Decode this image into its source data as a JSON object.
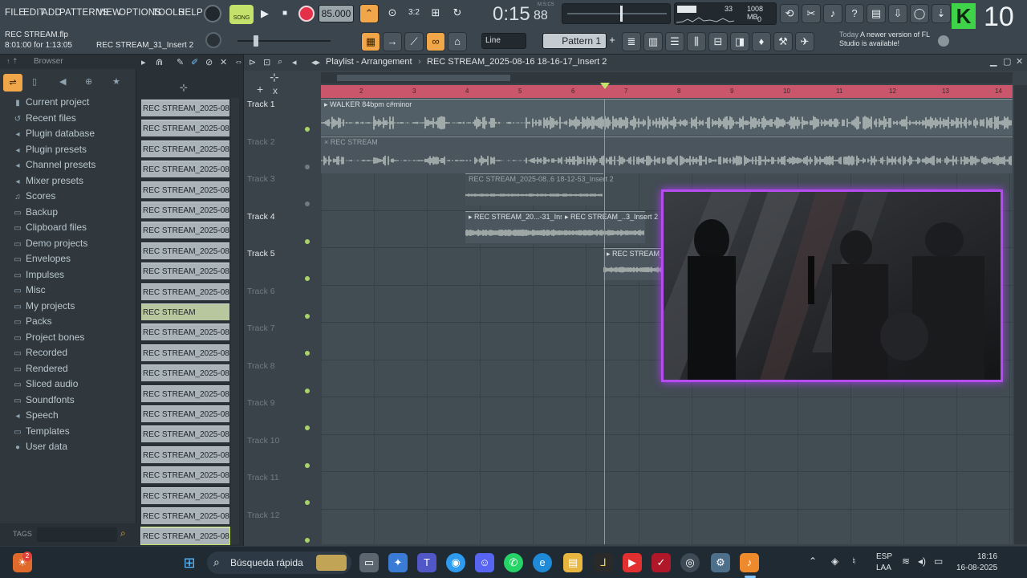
{
  "menu": [
    "FILE",
    "EDIT",
    "ADD",
    "PATTERNS",
    "VIEW",
    "OPTIONS",
    "TOOLS",
    "HELP"
  ],
  "transport": {
    "song_label": "SONG",
    "tempo": "85.000",
    "time": "0:15",
    "time_sub": "88",
    "time_unit": "M:S:CS",
    "cpu": "33",
    "memory": "1008 MB",
    "voices": "0"
  },
  "project": {
    "file": "REC STREAM.flp",
    "position": "8:01:00 for 1:13:05",
    "insert": "REC STREAM_31_Insert 2"
  },
  "toolbar": {
    "snap": "Line",
    "pattern": "Pattern 1",
    "badge": "10"
  },
  "news": {
    "today": "Today",
    "message": "A newer version of FL Studio is available!"
  },
  "browser": {
    "title": "Browser",
    "tags_label": "TAGS",
    "items": [
      {
        "label": "Current project",
        "icon": "project-icon"
      },
      {
        "label": "Recent files",
        "icon": "recent-icon"
      },
      {
        "label": "Plugin database",
        "icon": "plugin-icon"
      },
      {
        "label": "Plugin presets",
        "icon": "plugin-icon"
      },
      {
        "label": "Channel presets",
        "icon": "plugin-icon"
      },
      {
        "label": "Mixer presets",
        "icon": "plugin-icon"
      },
      {
        "label": "Scores",
        "icon": "note-icon"
      },
      {
        "label": "Backup",
        "icon": "folder-icon"
      },
      {
        "label": "Clipboard files",
        "icon": "folder-icon"
      },
      {
        "label": "Demo projects",
        "icon": "folder-icon"
      },
      {
        "label": "Envelopes",
        "icon": "folder-icon"
      },
      {
        "label": "Impulses",
        "icon": "folder-icon"
      },
      {
        "label": "Misc",
        "icon": "folder-icon"
      },
      {
        "label": "My projects",
        "icon": "folder-icon"
      },
      {
        "label": "Packs",
        "icon": "folder-icon"
      },
      {
        "label": "Project bones",
        "icon": "folder-icon"
      },
      {
        "label": "Recorded",
        "icon": "folder-icon"
      },
      {
        "label": "Rendered",
        "icon": "folder-icon"
      },
      {
        "label": "Sliced audio",
        "icon": "folder-icon"
      },
      {
        "label": "Soundfonts",
        "icon": "folder-icon"
      },
      {
        "label": "Speech",
        "icon": "speech-icon"
      },
      {
        "label": "Templates",
        "icon": "folder-icon"
      },
      {
        "label": "User data",
        "icon": "user-icon"
      }
    ]
  },
  "clips": [
    "REC STREAM_2025-08-16...",
    "REC STREAM_2025-08-16...",
    "REC STREAM_2025-08-16...",
    "REC STREAM_2025-08-16...",
    "REC STREAM_2025-08-16...",
    "REC STREAM_2025-08-16...",
    "REC STREAM_2025-08-16...",
    "REC STREAM_2025-08-16...",
    "REC STREAM_2025-08-16...",
    "REC STREAM_2025-08-16...",
    "REC STREAM",
    "REC STREAM_2025-08-16...",
    "REC STREAM_2025-08-16...",
    "REC STREAM_2025-08-16...",
    "REC STREAM_2025-08-16...",
    "REC STREAM_2025-08-16...",
    "REC STREAM_2025-08-16...",
    "REC STREAM_2025-08-16...",
    "REC STREAM_2025-08-16...",
    "REC STREAM_2025-08-16...",
    "REC STREAM_2025-08-16...",
    "REC STREAM_2025-08-16..."
  ],
  "playlist": {
    "title": "Playlist - Arrangement",
    "pattern_path": "REC STREAM_2025-08-16 18-16-17_Insert 2",
    "bars": [
      "2",
      "3",
      "4",
      "5",
      "6",
      "7",
      "8",
      "9",
      "10",
      "11",
      "12",
      "13",
      "14"
    ],
    "tracks": [
      "Track 1",
      "Track 2",
      "Track 3",
      "Track 4",
      "Track 5",
      "Track 6",
      "Track 7",
      "Track 8",
      "Track 9",
      "Track 10",
      "Track 11",
      "Track 12"
    ],
    "clips": [
      {
        "name": "WALKER 84bpm c#minor"
      },
      {
        "name": "REC STREAM"
      },
      {
        "name": "REC STREAM_2025-08..6 18-12-53_Insert 2"
      },
      {
        "name": "REC STREAM_20...-31_Insert 2"
      },
      {
        "name": "REC STREAM_..3_Insert 2"
      },
      {
        "name": "REC STREAM_20"
      }
    ]
  },
  "taskbar": {
    "search": "Búsqueda rápida",
    "lang1": "ESP",
    "lang2": "LAA",
    "time": "18:16",
    "date": "16-08-2025",
    "badge": "2"
  }
}
